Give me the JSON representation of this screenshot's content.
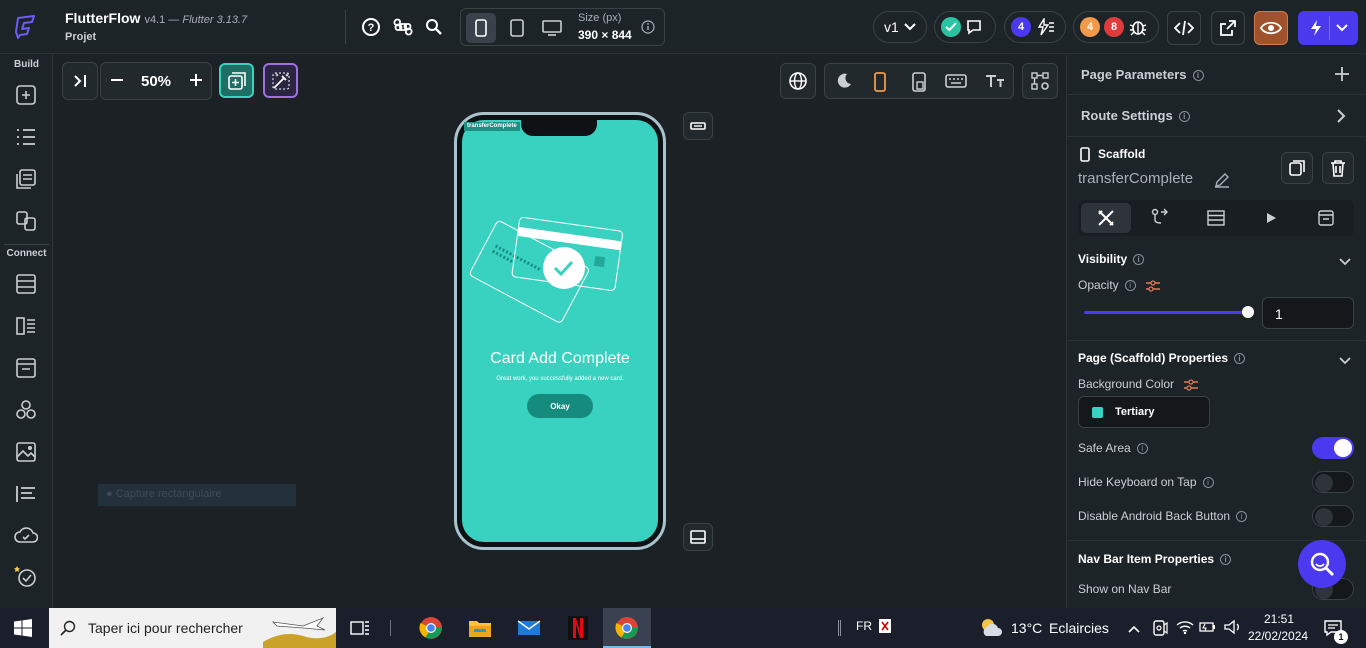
{
  "header": {
    "app_name": "FlutterFlow",
    "version": "v4.1 — ",
    "flutter_version": "Flutter 3.13.7",
    "project_label": "Projet",
    "size_label": "Size (px)",
    "size_value": "390 × 844",
    "branch": "v1",
    "badge_purple": "4",
    "badge_orange": "4",
    "badge_red": "8"
  },
  "sidebar": {
    "build_label": "Build",
    "connect_label": "Connect"
  },
  "canvas": {
    "zoom": "50%",
    "capture_text": "Capture rectangulaire"
  },
  "phone_screen": {
    "page_tag": "transferComplete",
    "title": "Card Add Complete",
    "subtitle": "Great work, you successfully added a new card.",
    "button": "Okay",
    "background_color": "#39d2c0"
  },
  "panel": {
    "page_parameters": "Page Parameters",
    "route_settings": "Route Settings",
    "widget_type": "Scaffold",
    "widget_name": "transferComplete",
    "visibility": "Visibility",
    "opacity_label": "Opacity",
    "opacity_value": "1",
    "opacity_level": 1,
    "page_props": "Page (Scaffold) Properties",
    "bg_color_label": "Background Color",
    "bg_color_value": "Tertiary",
    "bg_color_swatch": "#39d2c0",
    "safe_area": "Safe Area",
    "safe_area_on": true,
    "hide_keyboard": "Hide Keyboard on Tap",
    "hide_keyboard_on": false,
    "disable_back": "Disable Android Back Button",
    "disable_back_on": false,
    "nav_bar_props": "Nav Bar Item Properties",
    "show_on_nav": "Show on Nav Bar"
  },
  "taskbar": {
    "search_placeholder": "Taper ici pour rechercher",
    "language": "FR",
    "temperature": "13°C",
    "weather": "Eclaircies",
    "time": "21:51",
    "date": "22/02/2024",
    "notifications": "1"
  },
  "colors": {
    "accent": "#4b39ef",
    "teal": "#39d2c0",
    "dark_teal": "#158b7d"
  }
}
